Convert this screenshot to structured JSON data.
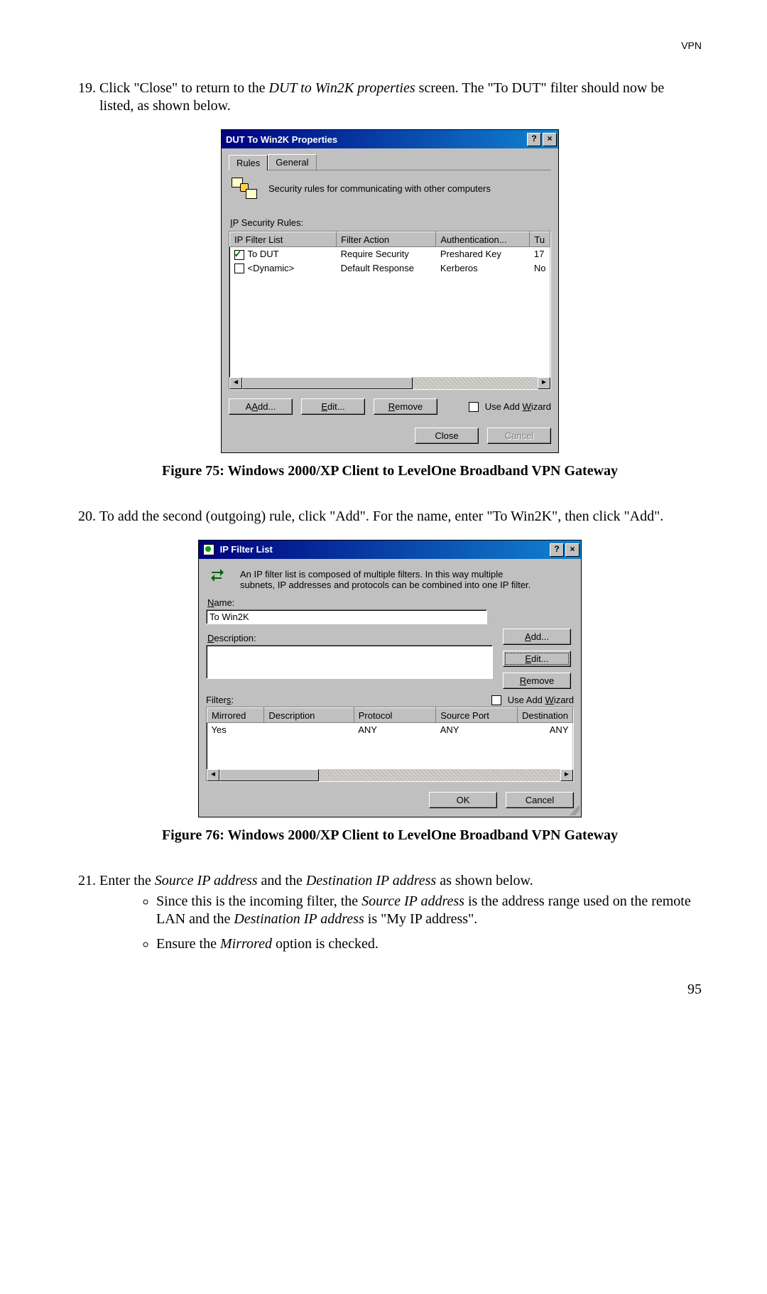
{
  "header_right": "VPN",
  "page_number": "95",
  "steps": {
    "s19_a": "Click \"Close\" to return to the ",
    "s19_b": "DUT to Win2K properties",
    "s19_c": " screen. The \"To DUT\" filter should now be listed, as shown below.",
    "s20": "To add the second (outgoing) rule, click \"Add\". For the name, enter \"To Win2K\", then click \"Add\".",
    "s21_a": "Enter the ",
    "s21_b": "Source IP address",
    "s21_c": " and the ",
    "s21_d": "Destination IP address",
    "s21_e": " as shown below."
  },
  "bullets": {
    "b1_a": "Since this is the incoming filter, the ",
    "b1_b": "Source IP address",
    "b1_c": " is the address range used on the remote LAN and the ",
    "b1_d": "Destination IP address",
    "b1_e": " is \"My IP address\".",
    "b2_a": "Ensure the ",
    "b2_b": "Mirrored",
    "b2_c": " option is checked."
  },
  "fig1_caption": "Figure 75: Windows 2000/XP Client to LevelOne Broadband VPN Gateway",
  "fig2_caption": "Figure 76: Windows 2000/XP Client to LevelOne Broadband VPN Gateway",
  "dlg1": {
    "title": "DUT To Win2K Properties",
    "help_btn": "?",
    "close_btn": "×",
    "tab_rules": "Rules",
    "tab_general": "General",
    "info_text": "Security rules for communicating with other computers",
    "list_label": "IP Security Rules:",
    "headers": {
      "c1": "IP Filter List",
      "c2": "Filter Action",
      "c3": "Authentication...",
      "c4": "Tu"
    },
    "rows": [
      {
        "checked": true,
        "filter": "To DUT",
        "action": "Require Security",
        "auth": "Preshared Key",
        "tu": "17"
      },
      {
        "checked": false,
        "filter": "<Dynamic>",
        "action": "Default Response",
        "auth": "Kerberos",
        "tu": "No"
      }
    ],
    "btn_add": "Add...",
    "btn_edit": "Edit...",
    "btn_remove": "Remove",
    "chk_wizard": "Use Add Wizard",
    "btn_close": "Close",
    "btn_cancel": "Cancel",
    "mn_a": "A",
    "mn_e": "E",
    "mn_r": "R",
    "mn_w": "W"
  },
  "dlg2": {
    "title": "IP Filter List",
    "help_btn": "?",
    "close_btn": "×",
    "info_text": "An IP filter list is composed of multiple filters. In this way multiple subnets, IP addresses and protocols can be combined into one IP filter.",
    "name_label": "Name:",
    "name_value": "To Win2K",
    "desc_label": "Description:",
    "btn_add": "Add...",
    "btn_edit": "Edit...",
    "btn_remove": "Remove",
    "chk_wizard": "Use Add Wizard",
    "filters_label": "Filters:",
    "headers": {
      "c1": "Mirrored",
      "c2": "Description",
      "c3": "Protocol",
      "c4": "Source Port",
      "c5": "Destination"
    },
    "rows": [
      {
        "mirrored": "Yes",
        "desc": "",
        "proto": "ANY",
        "src": "ANY",
        "dst": "ANY"
      }
    ],
    "btn_ok": "OK",
    "btn_cancel": "Cancel",
    "mn_n": "N",
    "mn_d": "D",
    "mn_a": "A",
    "mn_e": "E",
    "mn_r": "R",
    "mn_w": "W",
    "mn_s": "s"
  }
}
